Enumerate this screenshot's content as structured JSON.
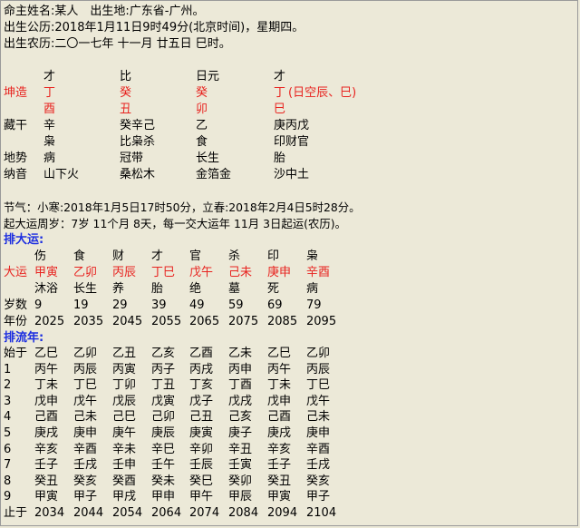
{
  "header": {
    "name_line": "命主姓名:某人　出生地:广东省-广州。",
    "solar_line": "出生公历:2018年1月11日9时49分(北京时间)，星期四。",
    "lunar_line": "出生农历:二〇一七年 十一月 廿五日 巳时。"
  },
  "chart": {
    "gods": [
      "才",
      "比",
      "日元",
      "才"
    ],
    "row_label": "坤造",
    "stems": [
      "丁",
      "癸",
      "癸",
      "丁"
    ],
    "void_note": "(日空辰、巳)",
    "branches": [
      "酉",
      "丑",
      "卯",
      "巳"
    ],
    "hidden_label": "藏干",
    "hidden": [
      "辛",
      "癸辛己",
      "乙",
      "庚丙戊"
    ],
    "hidden_gods": [
      "枭",
      "比枭杀",
      "食",
      "印财官"
    ],
    "terrain_label": "地势",
    "terrain": [
      "病",
      "冠带",
      "长生",
      "胎"
    ],
    "nayin_label": "纳音",
    "nayin": [
      "山下火",
      "桑松木",
      "金箔金",
      "沙中土"
    ]
  },
  "info": {
    "jieqi_line": "节气：小寒:2018年1月5日17时50分，立春:2018年2月4日5时28分。",
    "qiyun_line": "起大运周岁：7岁 11个月 8天，每一交大运年 11月 3日起运(农历)。"
  },
  "dayun": {
    "heading": "排大运:",
    "gods": [
      "伤",
      "食",
      "财",
      "才",
      "官",
      "杀",
      "印",
      "枭"
    ],
    "row_label": "大运",
    "pillars": [
      "甲寅",
      "乙卯",
      "丙辰",
      "丁巳",
      "戊午",
      "己未",
      "庚申",
      "辛酉"
    ],
    "terrain": [
      "沐浴",
      "长生",
      "养",
      "胎",
      "绝",
      "墓",
      "死",
      "病"
    ],
    "age_label": "岁数",
    "ages": [
      "9",
      "19",
      "29",
      "39",
      "49",
      "59",
      "69",
      "79"
    ],
    "year_label": "年份",
    "years": [
      "2025",
      "2035",
      "2045",
      "2055",
      "2065",
      "2075",
      "2085",
      "2095"
    ]
  },
  "liunian": {
    "heading": "排流年:",
    "rows": [
      {
        "label": "始于",
        "cells": [
          "乙巳",
          "乙卯",
          "乙丑",
          "乙亥",
          "乙酉",
          "乙未",
          "乙巳",
          "乙卯"
        ]
      },
      {
        "label": "1",
        "cells": [
          "丙午",
          "丙辰",
          "丙寅",
          "丙子",
          "丙戌",
          "丙申",
          "丙午",
          "丙辰"
        ]
      },
      {
        "label": "2",
        "cells": [
          "丁未",
          "丁巳",
          "丁卯",
          "丁丑",
          "丁亥",
          "丁酉",
          "丁未",
          "丁巳"
        ]
      },
      {
        "label": "3",
        "cells": [
          "戊申",
          "戊午",
          "戊辰",
          "戊寅",
          "戊子",
          "戊戌",
          "戊申",
          "戊午"
        ]
      },
      {
        "label": "4",
        "cells": [
          "己酉",
          "己未",
          "己巳",
          "己卯",
          "己丑",
          "己亥",
          "己酉",
          "己未"
        ]
      },
      {
        "label": "5",
        "cells": [
          "庚戌",
          "庚申",
          "庚午",
          "庚辰",
          "庚寅",
          "庚子",
          "庚戌",
          "庚申"
        ]
      },
      {
        "label": "6",
        "cells": [
          "辛亥",
          "辛酉",
          "辛未",
          "辛巳",
          "辛卯",
          "辛丑",
          "辛亥",
          "辛酉"
        ]
      },
      {
        "label": "7",
        "cells": [
          "壬子",
          "壬戌",
          "壬申",
          "壬午",
          "壬辰",
          "壬寅",
          "壬子",
          "壬戌"
        ]
      },
      {
        "label": "8",
        "cells": [
          "癸丑",
          "癸亥",
          "癸酉",
          "癸未",
          "癸巳",
          "癸卯",
          "癸丑",
          "癸亥"
        ]
      },
      {
        "label": "9",
        "cells": [
          "甲寅",
          "甲子",
          "甲戌",
          "甲申",
          "甲午",
          "甲辰",
          "甲寅",
          "甲子"
        ]
      },
      {
        "label": "止于",
        "cells": [
          "2034",
          "2044",
          "2054",
          "2064",
          "2074",
          "2084",
          "2094",
          "2104"
        ]
      }
    ]
  },
  "colors": {
    "background": "#ece9d8",
    "accent_red": "#e8231f",
    "heading_blue": "#1c2ee0"
  }
}
